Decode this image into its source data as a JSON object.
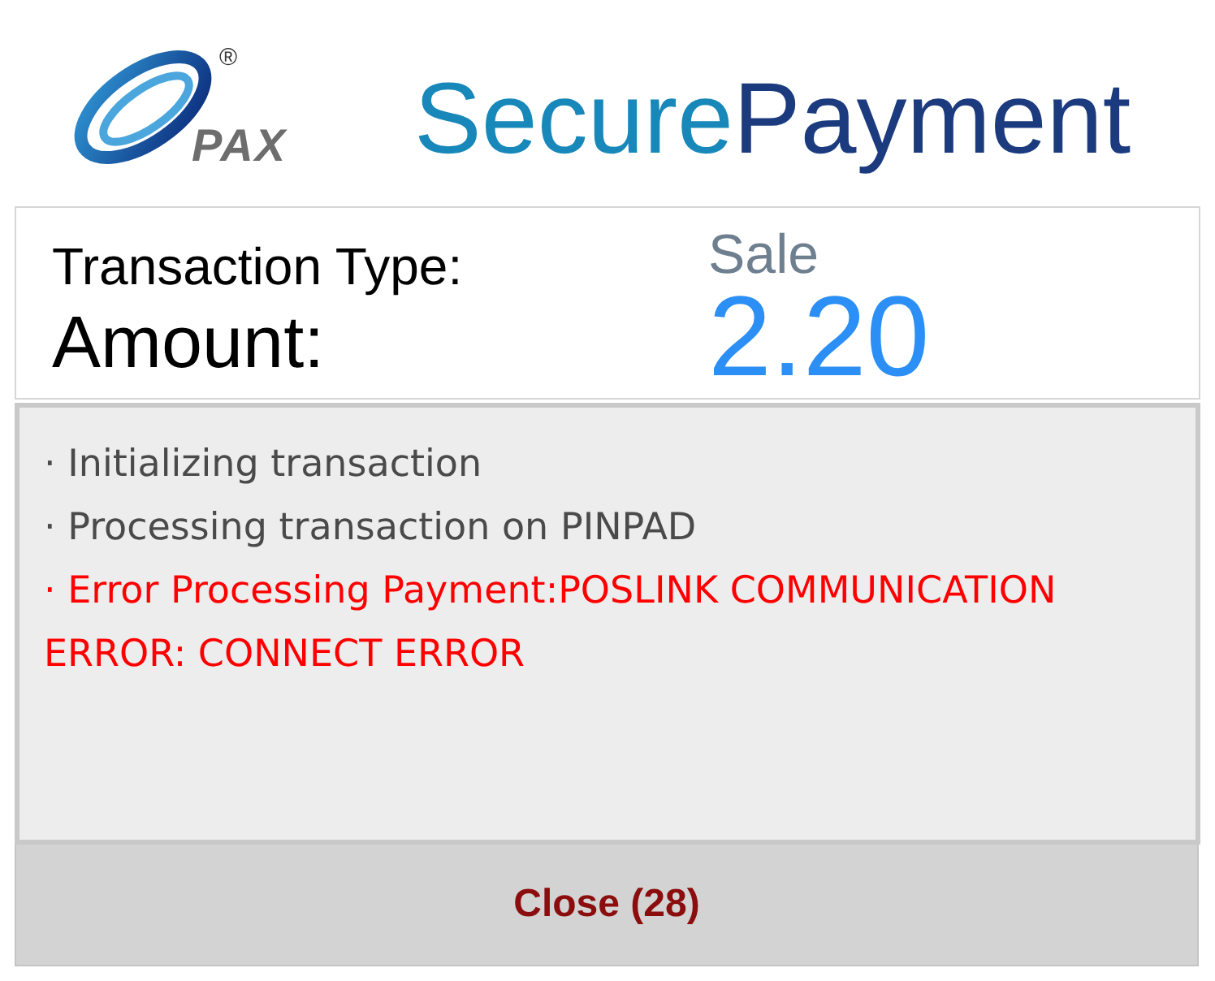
{
  "header": {
    "logo": {
      "wordmark": "PAX",
      "mark": "®"
    },
    "title": {
      "part_1": "Secure",
      "part_2": "Payment"
    }
  },
  "transaction": {
    "type_label": "Transaction Type:",
    "type_value": "Sale",
    "amount_label": "Amount:",
    "amount_value": "2.20"
  },
  "log": [
    {
      "kind": "info",
      "text": "· Initializing transaction"
    },
    {
      "kind": "info",
      "text": "· Processing transaction on PINPAD"
    },
    {
      "kind": "error",
      "text": "· Error Processing Payment:POSLINK COMMUNICATION ERROR: CONNECT ERROR"
    }
  ],
  "close_button": {
    "label": "Close (28)"
  }
}
